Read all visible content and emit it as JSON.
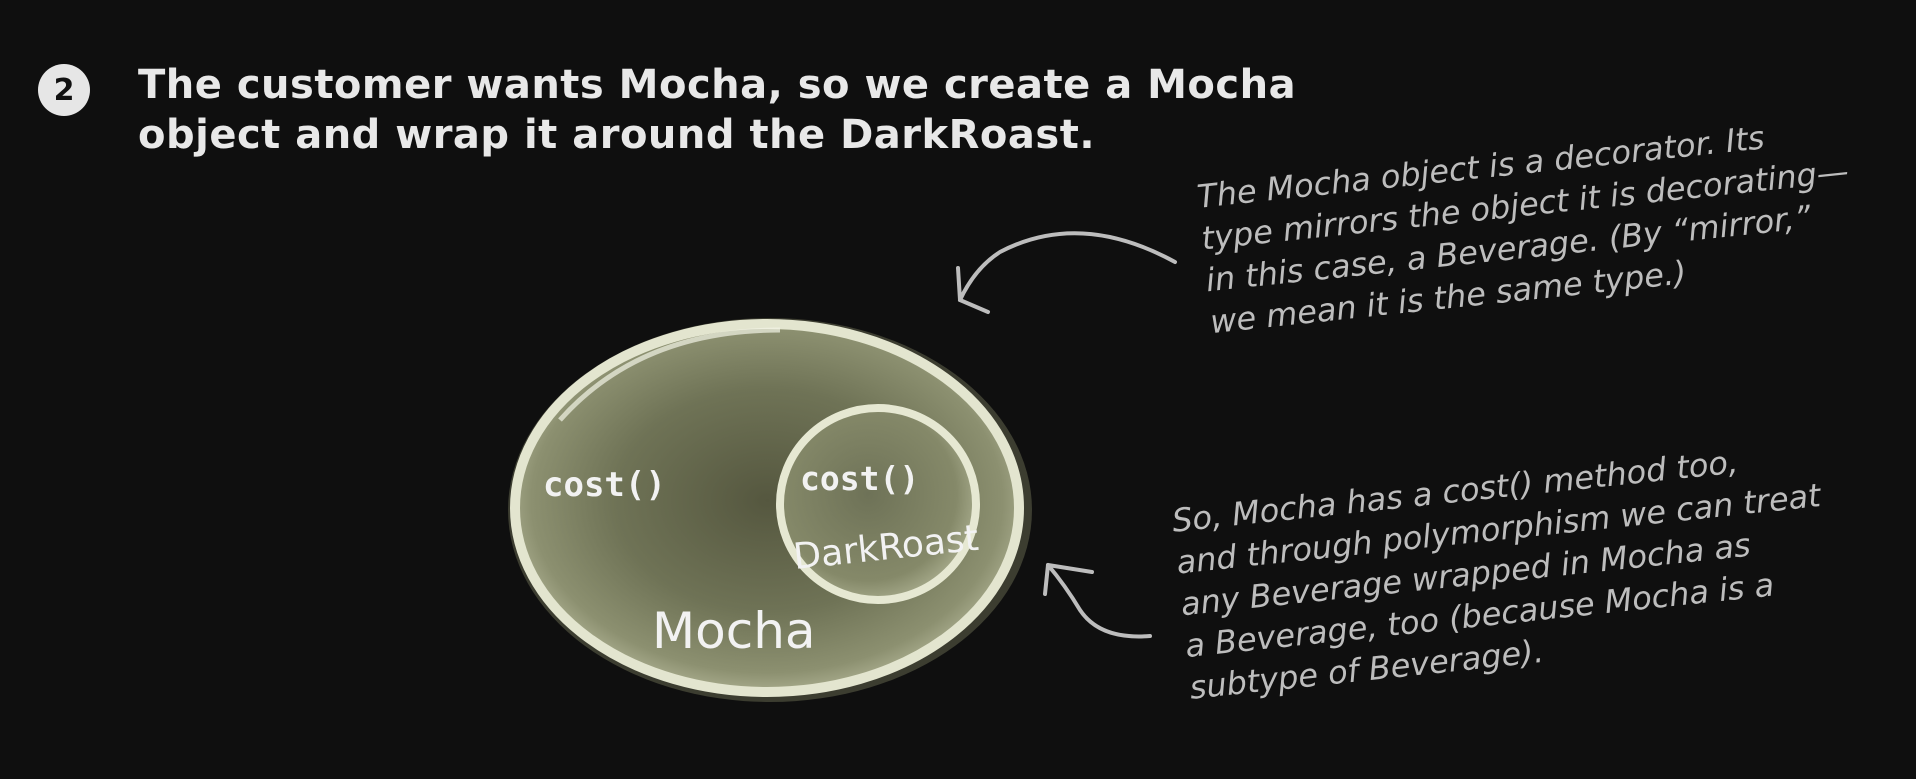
{
  "step": {
    "number": "2"
  },
  "heading": {
    "line1": "The customer wants Mocha, so we create a Mocha",
    "line2": "object and wrap it around the DarkRoast."
  },
  "outer_object": {
    "method_label": "cost()",
    "name_label": "Mocha"
  },
  "inner_object": {
    "method_label": "cost()",
    "name_label": "DarkRoast"
  },
  "annotations": {
    "decorator_note": {
      "lines": [
        "The Mocha object is a decorator. Its",
        "type mirrors the object it is decorating—",
        "in this case, a Beverage. (By “mirror,”",
        "we mean it is the same type.)"
      ]
    },
    "polymorphism_note": {
      "lines": [
        "So, Mocha has a cost() method too,",
        "and through polymorphism we can treat",
        "any Beverage wrapped in Mocha as",
        "a Beverage, too (because Mocha is a",
        "subtype of Beverage)."
      ]
    }
  },
  "colors": {
    "background": "#0f0f0f",
    "object_fill": "#7f8366",
    "object_rim": "#e3e5cf",
    "text": "#e6e6e6",
    "note_text": "#bdbdbd"
  }
}
